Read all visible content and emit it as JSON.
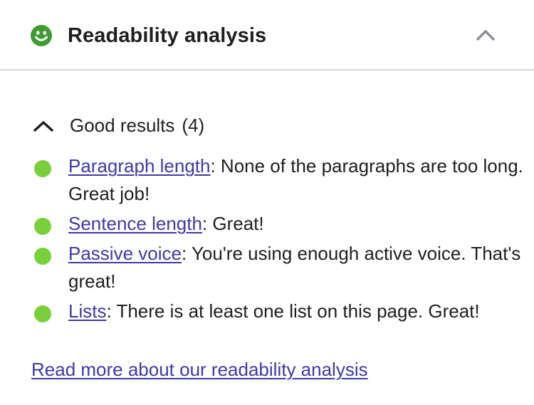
{
  "panel": {
    "title": "Readability analysis",
    "status_color": "#3c9c2f",
    "status_icon": "smiley-icon",
    "collapse_icon": "chevron-up-icon"
  },
  "good_results": {
    "heading": "Good results",
    "count": "(4)",
    "toggle_icon": "chevron-up-icon",
    "bullet_color": "#7ad03a",
    "items": [
      {
        "link": "Paragraph length",
        "text": ": None of the paragraphs are too long. Great job!"
      },
      {
        "link": "Sentence length",
        "text": ": Great!"
      },
      {
        "link": "Passive voice",
        "text": ": You're using enough active voice. That's great!"
      },
      {
        "link": "Lists",
        "text": ": There is at least one list on this page. Great!"
      }
    ]
  },
  "footer": {
    "link": "Read more about our readability analysis"
  },
  "colors": {
    "link": "#4037a8",
    "divider": "#dcdcde",
    "text": "#1e1e1e"
  }
}
